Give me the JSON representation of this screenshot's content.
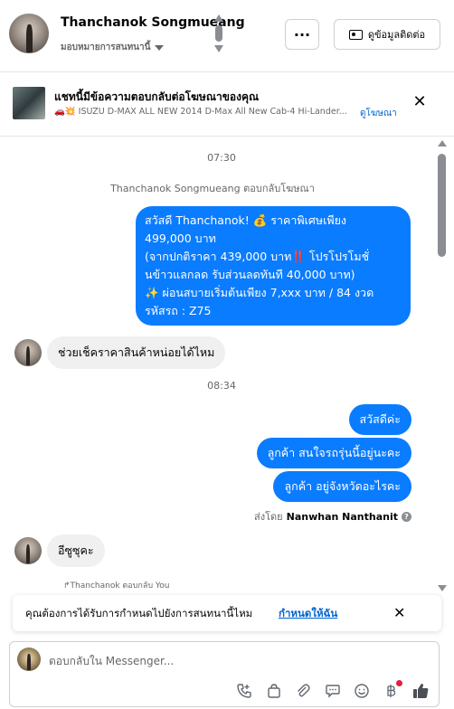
{
  "header": {
    "name": "Thanchanok Songmueang",
    "assignee": "มอบหมายการสนทนานี้",
    "more_label": "···",
    "contact_button": "ดูข้อมูลติดต่อ"
  },
  "ad": {
    "title": "แชทนี้มีข้อความตอบกลับต่อโฆษณาของคุณ",
    "line": "🚗💥 ISUZU D-MAX ALL NEW 2014 D-Max All New Cab-4 Hi-Lander...",
    "link": "ดูโฆษณา",
    "close": "✕"
  },
  "messages": {
    "time1": "07:30",
    "system": "Thanchanok Songmueang ตอบกลับโฆษณา",
    "ad_reply": [
      "สวัสดี Thanchanok! 💰 ราคาพิเศษเพียง",
      "499,000 บาท",
      "(จากปกติราคา 439,000 บาท‼️ โปรโปรโมชั่",
      "นข้าวแลกลด รับส่วนลดทันที 40,000 บาท)",
      "✨ ผ่อนสบายเริ่มต้นเพียง 7,xxx บาท / 84 งวด",
      " รหัสรถ : Z75"
    ],
    "in1": "ช่วยเช็คราคาสินค้าหน่อยได้ไหม",
    "time2": "08:34",
    "out1": "สวัสดีค่ะ",
    "out2": "ลูกค้า สนใจรถรุ่นนี้อยู่นะคะ",
    "out3": "ลูกค้า อยู่จังหวัดอะไรคะ",
    "sent_by_prefix": "ส่งโดย",
    "sent_by_name": "Nanwhan Nanthanit",
    "info": "?",
    "in2": "อีซูซุคะ",
    "reply_tag": "↱Thanchanok ตอบกลับ You"
  },
  "suggestion": {
    "text": "คุณต้องการได้รับการกำหนดไปยังการสนทนานี้ไหม",
    "link": "กำหนดให้ฉัน",
    "close": "✕"
  },
  "composer": {
    "placeholder": "ตอบกลับใน Messenger...",
    "tools": [
      "phone-plus-icon",
      "shopping-bag-icon",
      "paperclip-icon",
      "chat-bubble-icon",
      "emoji-icon",
      "baht-icon",
      "thumbs-up-icon"
    ]
  },
  "colors": {
    "accent": "#0a7cff",
    "link": "#0064d1",
    "muted": "#65676b",
    "incoming_bg": "#f0f0f0",
    "notify_dot": "#e41e3f"
  }
}
